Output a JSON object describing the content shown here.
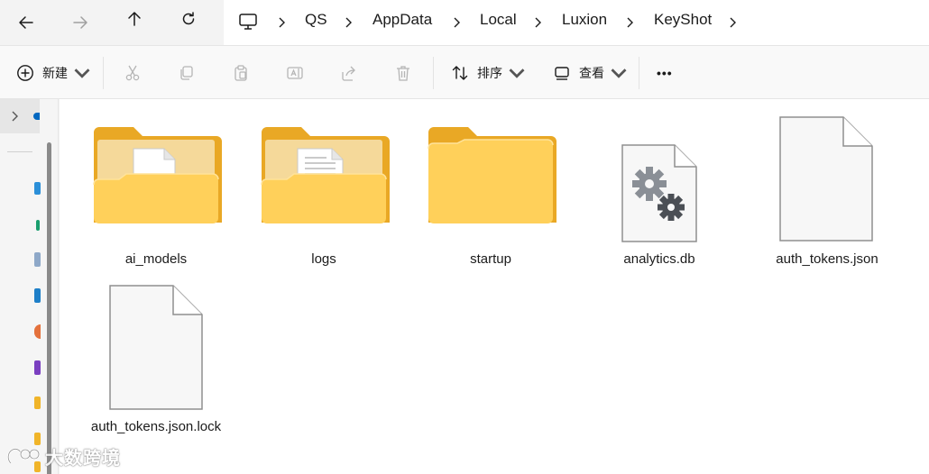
{
  "nav": {
    "back": "back-arrow",
    "forward": "forward-arrow",
    "up": "up-arrow",
    "refresh": "refresh"
  },
  "breadcrumb": [
    "QS",
    "AppData",
    "Local",
    "Luxion",
    "KeyShot"
  ],
  "toolbar": {
    "new_label": "新建",
    "sort_label": "排序",
    "view_label": "查看",
    "more_label": "•••"
  },
  "files": [
    {
      "name": "ai_models",
      "kind": "folder-doc"
    },
    {
      "name": "logs",
      "kind": "folder-lines"
    },
    {
      "name": "startup",
      "kind": "folder-empty"
    },
    {
      "name": "analytics.db",
      "kind": "db-file"
    },
    {
      "name": "auth_tokens.json",
      "kind": "blank-file"
    },
    {
      "name": "auth_tokens.json.lock",
      "kind": "blank-file"
    }
  ],
  "watermark": "大数跨境",
  "colors": {
    "folder_back": "#e9a825",
    "folder_front": "#ffd05a",
    "accent": "#0067c0"
  }
}
